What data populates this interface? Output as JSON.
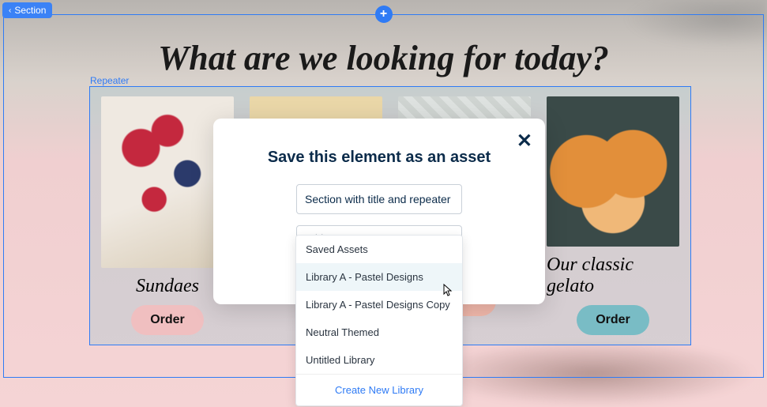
{
  "editor": {
    "section_label": "Section",
    "repeater_label": "Repeater",
    "add_button": "+"
  },
  "page": {
    "title": "What are we looking for today?"
  },
  "cards": [
    {
      "name": "Sundaes",
      "button_label": "Order",
      "button_style": "b-pink"
    },
    {
      "name": "",
      "button_label": "",
      "button_style": "b-teal"
    },
    {
      "name": "",
      "button_label": "rder",
      "button_style": "b-peach"
    },
    {
      "name": "Our classic gelato",
      "button_label": "Order",
      "button_style": "b-teal"
    }
  ],
  "modal": {
    "title": "Save this element as an asset",
    "asset_name_value": "Section with title and repeater",
    "select_placeholder": "Add to",
    "close_label": "✕"
  },
  "dropdown": {
    "options": [
      "Saved Assets",
      "Library A - Pastel Designs",
      "Library A - Pastel Designs Copy",
      "Neutral Themed",
      "Untitled Library"
    ],
    "hovered_index": 1,
    "create_label": "Create New Library"
  }
}
